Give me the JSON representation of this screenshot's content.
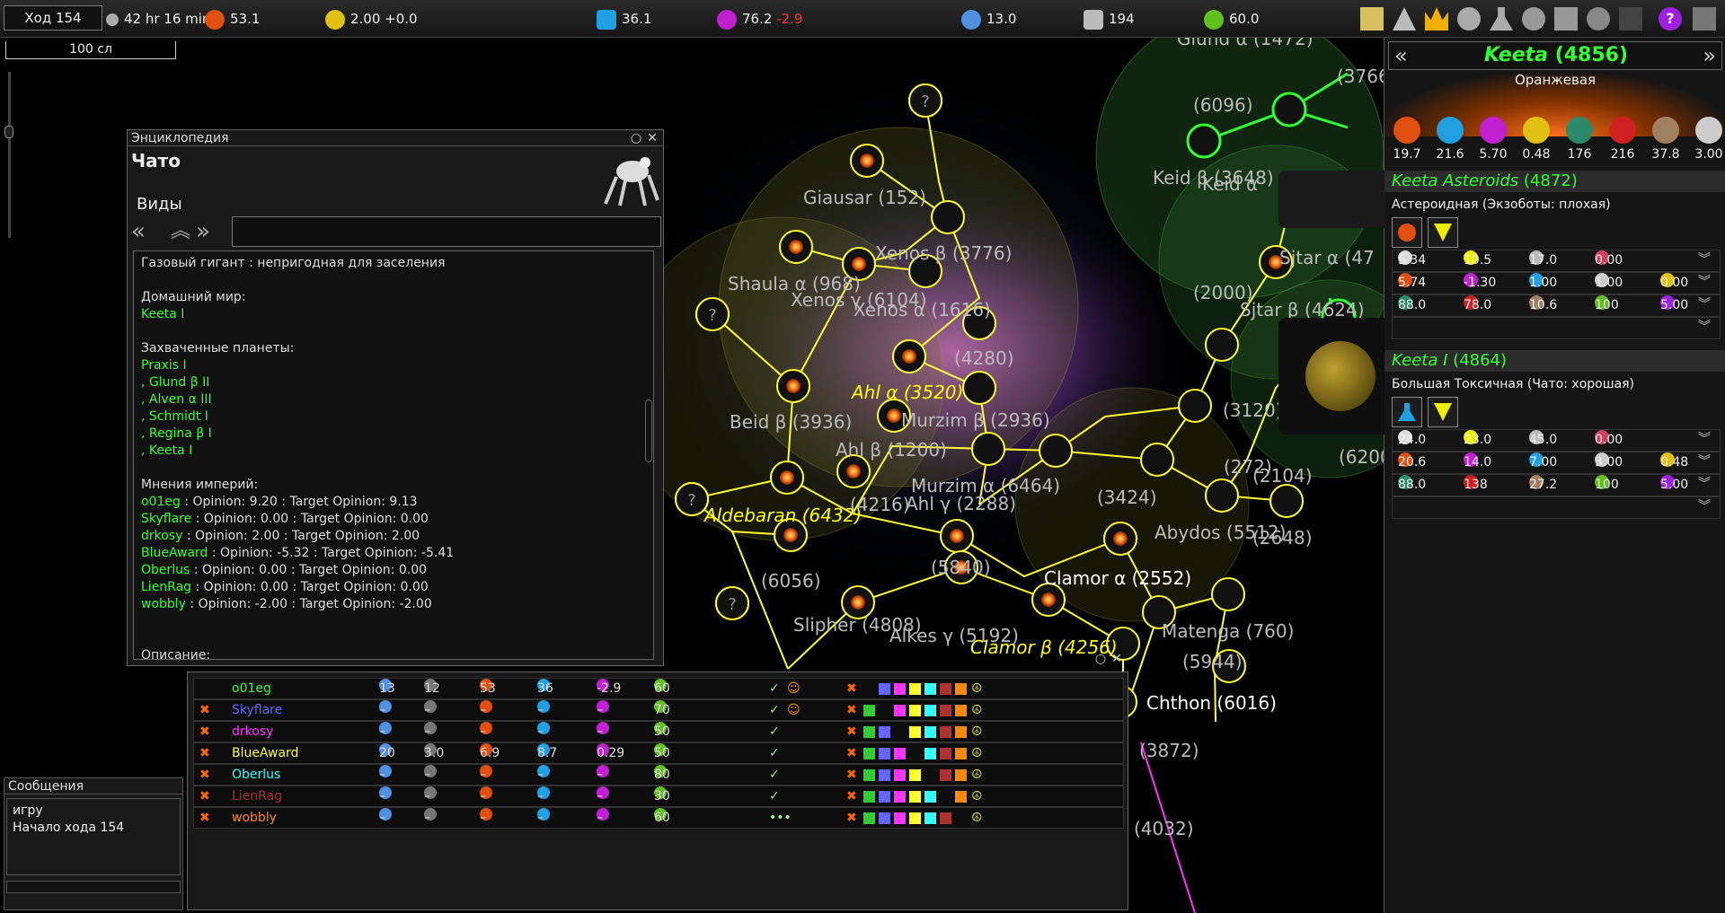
{
  "topbar": {
    "turn": "Ход 154",
    "time": "42 hr 16 min",
    "industry": "53.1",
    "trade": "2.00 +0.0",
    "research": "36.1",
    "influence": "76.2",
    "influence_delta": "-2.9",
    "fleet": "13.0",
    "population": "194",
    "stability": "60.0",
    "icons": [
      "messages-icon",
      "warning-icon",
      "crown-icon",
      "galaxy-icon",
      "research-icon",
      "gear-icon",
      "tech-icon",
      "empires-icon",
      "graph-icon",
      "help-icon"
    ]
  },
  "scale": "100 сл",
  "encyclopedia": {
    "title": "Энциклопедия",
    "name": "Чато",
    "category": "Виды",
    "lines": [
      {
        "t": "Газовый гигант : непригодная для заселения",
        "c": ""
      },
      {
        "t": "",
        "c": ""
      },
      {
        "t": "Домашний мир:",
        "c": ""
      },
      {
        "t": "Keeta I",
        "c": "g"
      },
      {
        "t": "",
        "c": ""
      },
      {
        "t": "Захваченные планеты:",
        "c": ""
      },
      {
        "t": "Praxis I",
        "c": "g"
      },
      {
        "t": ",  Glund β II",
        "c": "g"
      },
      {
        "t": ",  Alven α III",
        "c": "g"
      },
      {
        "t": ",  Schmidt I",
        "c": "g"
      },
      {
        "t": ",  Regina β I",
        "c": "g"
      },
      {
        "t": ",  Keeta I",
        "c": "g"
      },
      {
        "t": "",
        "c": ""
      },
      {
        "t": "Мнения империй:",
        "c": ""
      }
    ],
    "opinions": [
      {
        "name": "o01eg",
        "color": "#3f3",
        "text": " : Opinion: 9.20 : Target Opinion: 9.13"
      },
      {
        "name": "Skyflare",
        "color": "#3f3",
        "text": " : Opinion: 0.00 : Target Opinion: 0.00"
      },
      {
        "name": "drkosy",
        "color": "#3f3",
        "text": " : Opinion: 2.00 : Target Opinion: 2.00"
      },
      {
        "name": "BlueAward",
        "color": "#3f3",
        "text": " : Opinion: -5.32 : Target Opinion: -5.41"
      },
      {
        "name": "Oberlus",
        "color": "#3f3",
        "text": " : Opinion: 0.00 : Target Opinion: 0.00"
      },
      {
        "name": "LienRag",
        "color": "#3f3",
        "text": " : Opinion: 0.00 : Target Opinion: 0.00"
      },
      {
        "name": "wobbly",
        "color": "#3f3",
        "text": " : Opinion: -2.00 : Target Opinion: -2.00"
      }
    ],
    "desc": "Описание:"
  },
  "messages": {
    "title": "Сообщения",
    "lines": [
      "игру",
      "Начало хода 154"
    ]
  },
  "empires": [
    {
      "name": "o01eg",
      "color": "#3f3",
      "fleet": "13",
      "ships": "12",
      "ind": "53",
      "res": "36",
      "inf": "-2.9",
      "stab": "60",
      "check": "✓",
      "war": false,
      "extra": "person"
    },
    {
      "name": "Skyflare",
      "color": "#66f",
      "fleet": "–",
      "ships": "–",
      "ind": "–",
      "res": "–",
      "inf": "–",
      "stab": "70",
      "check": "✓",
      "war": true,
      "extra": "person"
    },
    {
      "name": "drkosy",
      "color": "#f3f",
      "fleet": "–",
      "ships": "–",
      "ind": "–",
      "res": "–",
      "inf": "–",
      "stab": "50",
      "check": "✓",
      "war": true,
      "extra": ""
    },
    {
      "name": "BlueAward",
      "color": "#ff3",
      "fleet": "20",
      "ships": "3.0",
      "ind": "6.9",
      "res": "8.7",
      "inf": "0.29",
      "stab": "50",
      "check": "✓",
      "war": true,
      "extra": ""
    },
    {
      "name": "Oberlus",
      "color": "#3ff",
      "fleet": "–",
      "ships": "–",
      "ind": "–",
      "res": "–",
      "inf": "–",
      "stab": "80",
      "check": "✓",
      "war": true,
      "extra": ""
    },
    {
      "name": "LienRag",
      "color": "#a33",
      "fleet": "–",
      "ships": "–",
      "ind": "–",
      "res": "–",
      "inf": "–",
      "stab": "30",
      "check": "✓",
      "war": true,
      "extra": ""
    },
    {
      "name": "wobbly",
      "color": "#f80",
      "fleet": "–",
      "ships": "–",
      "ind": "–",
      "res": "–",
      "inf": "–",
      "stab": "60",
      "check": "•••",
      "war": true,
      "extra": ""
    }
  ],
  "side": {
    "system": "Keeta",
    "system_id": "(4856)",
    "star": "Оранжевая",
    "resources": [
      "19.7",
      "21.6",
      "5.70",
      "0.48",
      "176",
      "216",
      "37.8",
      "3.00"
    ],
    "planets": [
      {
        "name": "Keeta Asteroids",
        "id": "(4872)",
        "type": "Астероидная (Экзоботы: плохая)",
        "rows": [
          [
            "5.34",
            "10.5",
            "17.0",
            "0.00"
          ],
          [
            "5.74",
            "-1.30",
            "1.00",
            "1.00",
            "0.00"
          ],
          [
            "88.0",
            "78.0",
            "10.6",
            "100",
            "5.00"
          ]
        ]
      },
      {
        "name": "Keeta I",
        "id": "(4864)",
        "type": "Большая Токсичная (Чато: хорошая)",
        "rows": [
          [
            "24.0",
            "23.0",
            "45.0",
            "0.00"
          ],
          [
            "20.6",
            "14.0",
            "7.00",
            "3.00",
            "0.48"
          ],
          [
            "88.0",
            "138",
            "27.2",
            "100",
            "5.00"
          ]
        ]
      }
    ]
  },
  "map_labels": [
    {
      "t": "Glund α (1472)",
      "c": "lbl"
    },
    {
      "t": "(3766)",
      "c": "lbl"
    },
    {
      "t": "(6096)",
      "c": "lbl"
    },
    {
      "t": "Keid β (3648)",
      "c": "lbl"
    },
    {
      "t": "Keid α",
      "c": "lbl"
    },
    {
      "t": "Giausar (152)",
      "c": "lbl"
    },
    {
      "t": "Xenos β (3776)",
      "c": "lbl"
    },
    {
      "t": "Shaula α (968)",
      "c": "lbl"
    },
    {
      "t": "Xenos γ (6104)",
      "c": "lbl"
    },
    {
      "t": "Xenos α (1616)",
      "c": "lbl"
    },
    {
      "t": "(4280)",
      "c": "lbl"
    },
    {
      "t": "Ahl α (3520)",
      "c": "lbl-y"
    },
    {
      "t": "Beid β (3936)",
      "c": "lbl"
    },
    {
      "t": "Murzim β (2936)",
      "c": "lbl"
    },
    {
      "t": "Ahl β (1200)",
      "c": "lbl"
    },
    {
      "t": "Murzim α (6464)",
      "c": "lbl"
    },
    {
      "t": "Aldebaran (6432)",
      "c": "lbl-y"
    },
    {
      "t": "(4216)",
      "c": "lbl"
    },
    {
      "t": "Ahl γ (2288)",
      "c": "lbl"
    },
    {
      "t": "(6056)",
      "c": "lbl"
    },
    {
      "t": "(5840)",
      "c": "lbl"
    },
    {
      "t": "Slipher (4808)",
      "c": "lbl"
    },
    {
      "t": "Alkes γ (5192)",
      "c": "lbl"
    },
    {
      "t": "Clamor β (4256)",
      "c": "lbl-y"
    },
    {
      "t": "Clamor α (2552)",
      "c": "lbl-w"
    },
    {
      "t": "Abydos (5512)",
      "c": "lbl"
    },
    {
      "t": "(2648)",
      "c": "lbl"
    },
    {
      "t": "(3424)",
      "c": "lbl"
    },
    {
      "t": "(272)",
      "c": "lbl"
    },
    {
      "t": "(2104)",
      "c": "lbl"
    },
    {
      "t": "(3120)",
      "c": "lbl"
    },
    {
      "t": "(2000)",
      "c": "lbl"
    },
    {
      "t": "Sjtar β (4624)",
      "c": "lbl"
    },
    {
      "t": "Sjtar α (47",
      "c": "lbl"
    },
    {
      "t": "(6200",
      "c": "lbl"
    },
    {
      "t": "Matenga (760)",
      "c": "lbl"
    },
    {
      "t": "(5944)",
      "c": "lbl"
    },
    {
      "t": "Chthon (6016)",
      "c": "lbl-w"
    },
    {
      "t": "(3872)",
      "c": "lbl"
    },
    {
      "t": "(4032)",
      "c": "lbl"
    }
  ],
  "colors": {
    "player": "#33ff33",
    "lane": "#ffff33",
    "enemy_lane": "#ff33ff"
  }
}
